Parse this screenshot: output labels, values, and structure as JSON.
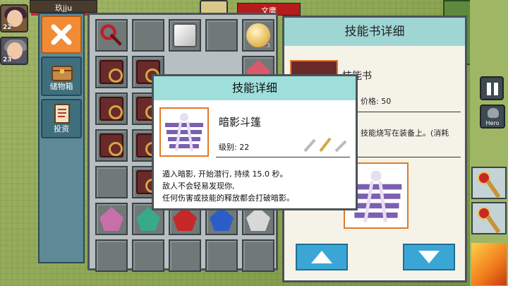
{
  "hud": {
    "player_name": "玖jju",
    "enemy_name": "文鹰",
    "avatar1_level": "22",
    "avatar2_level": "23"
  },
  "sidebar": {
    "storage_label": "储物箱",
    "invest_label": "投资"
  },
  "inventory": {
    "counts": {
      "slot4": "3",
      "slot_last": ""
    }
  },
  "detail_panel": {
    "title": "技能书详细",
    "item_name": "技能书",
    "price": "价格: 50",
    "desc": "技能烧写在装备上。(消耗"
  },
  "popup": {
    "title": "技能详细",
    "skill_name": "暗影斗篷",
    "level": "级别: 22",
    "desc_line1": "遁入暗影, 开始潜行, 持续 15.0 秒。",
    "desc_line2": "敌人不会轻易发现你,",
    "desc_line3": "任何伤害或技能的释放都会打破暗影。"
  },
  "right_col": {
    "hero_label": "Hero"
  },
  "colors": {
    "header_teal": "#9fdfdb",
    "accent_orange": "#f28b34",
    "arrow_blue": "#3aa6d6"
  }
}
